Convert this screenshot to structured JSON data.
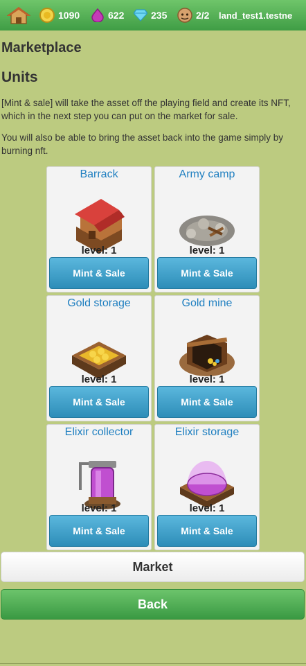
{
  "topbar": {
    "home_icon": "house-icon",
    "gold": {
      "icon": "gold-coin-icon",
      "value": "1090"
    },
    "elixir": {
      "icon": "elixir-drop-icon",
      "value": "622"
    },
    "gems": {
      "icon": "gem-icon",
      "value": "235"
    },
    "workers": {
      "icon": "builder-icon",
      "value": "2/2"
    },
    "account": "land_test1.testne"
  },
  "page_title": "Marketplace",
  "section_title": "Units",
  "description_1": "[Mint & sale] will take the asset off the playing field and create its NFT, which in the next step you can put on the market for sale.",
  "description_2": "You will also be able to bring the asset back into the game simply by burning nft.",
  "cards": [
    {
      "title": "Barrack",
      "level": "level: 1",
      "button": "Mint & Sale",
      "image": "barrack-image"
    },
    {
      "title": "Army camp",
      "level": "level: 1",
      "button": "Mint & Sale",
      "image": "army-camp-image"
    },
    {
      "title": "Gold storage",
      "level": "level: 1",
      "button": "Mint & Sale",
      "image": "gold-storage-image"
    },
    {
      "title": "Gold mine",
      "level": "level: 1",
      "button": "Mint & Sale",
      "image": "gold-mine-image"
    },
    {
      "title": "Elixir collector",
      "level": "level: 1",
      "button": "Mint & Sale",
      "image": "elixir-collector-image"
    },
    {
      "title": "Elixir storage",
      "level": "level: 1",
      "button": "Mint & Sale",
      "image": "elixir-storage-image"
    }
  ],
  "market_button": "Market",
  "back_button": "Back"
}
